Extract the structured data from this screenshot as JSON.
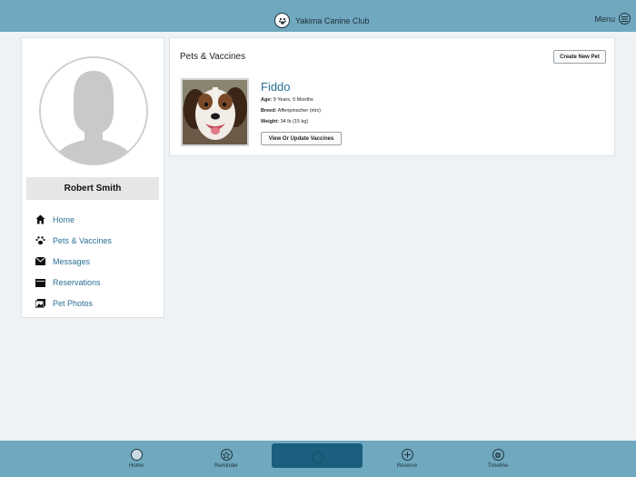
{
  "header": {
    "title": "Yakima Canine Club",
    "menu_label": "Menu"
  },
  "profile": {
    "name": "Robert Smith",
    "nav": [
      {
        "label": "Home",
        "icon": "home-icon"
      },
      {
        "label": "Pets & Vaccines",
        "icon": "paw-icon"
      },
      {
        "label": "Messages",
        "icon": "envelope-icon"
      },
      {
        "label": "Reservations",
        "icon": "calendar-icon"
      },
      {
        "label": "Pet Photos",
        "icon": "photos-icon"
      }
    ]
  },
  "main": {
    "section_title": "Pets & Vaccines",
    "create_button": "Create New Pet",
    "pet": {
      "name": "Fiddo",
      "age_label": "Age:",
      "age_value": "9 Years, 0 Months",
      "breed_label": "Breed:",
      "breed_value": "Affenpinscher (mix)",
      "weight_label": "Weight:",
      "weight_value": "34 lb (15 kg)",
      "vaccine_button": "View Or Update Vaccines"
    }
  },
  "tabbar": {
    "tabs": [
      {
        "label": "Home",
        "icon": "home-circle-icon"
      },
      {
        "label": "Reminder",
        "icon": "star-icon"
      },
      {
        "label": "",
        "icon": "active-tab-icon"
      },
      {
        "label": "Reserve",
        "icon": "plus-icon"
      },
      {
        "label": "Timeline",
        "icon": "timeline-icon"
      }
    ]
  },
  "colors": {
    "bar": "#6fa8bf",
    "accent": "#2a6e95",
    "active_tab": "#1b5f7e"
  }
}
